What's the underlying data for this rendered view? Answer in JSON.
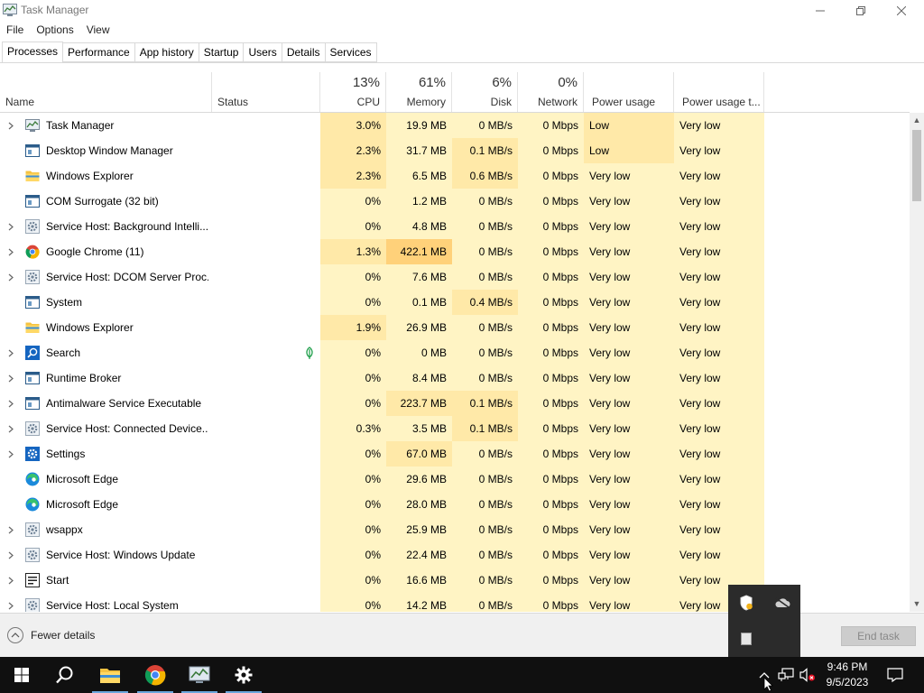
{
  "window": {
    "title": "Task Manager",
    "controls": {
      "minimize": "—",
      "maximize": "❐",
      "close": "✕"
    }
  },
  "menu": [
    "File",
    "Options",
    "View"
  ],
  "tabs": [
    "Processes",
    "Performance",
    "App history",
    "Startup",
    "Users",
    "Details",
    "Services"
  ],
  "active_tab": "Processes",
  "columns": {
    "name": "Name",
    "status": "Status",
    "cpu": {
      "pct": "13%",
      "label": "CPU"
    },
    "memory": {
      "pct": "61%",
      "label": "Memory"
    },
    "disk": {
      "pct": "6%",
      "label": "Disk"
    },
    "network": {
      "pct": "0%",
      "label": "Network"
    },
    "power": "Power usage",
    "power_trend": "Power usage t..."
  },
  "processes": [
    {
      "name": "Task Manager",
      "icon": "task-manager-icon",
      "expandable": true,
      "cpu": "3.0%",
      "memory": "19.9 MB",
      "disk": "0 MB/s",
      "network": "0 Mbps",
      "power": "Low",
      "power_trend": "Very low"
    },
    {
      "name": "Desktop Window Manager",
      "icon": "window-icon",
      "expandable": false,
      "cpu": "2.3%",
      "memory": "31.7 MB",
      "disk": "0.1 MB/s",
      "network": "0 Mbps",
      "power": "Low",
      "power_trend": "Very low"
    },
    {
      "name": "Windows Explorer",
      "icon": "folder-icon",
      "expandable": false,
      "cpu": "2.3%",
      "memory": "6.5 MB",
      "disk": "0.6 MB/s",
      "network": "0 Mbps",
      "power": "Very low",
      "power_trend": "Very low"
    },
    {
      "name": "COM Surrogate (32 bit)",
      "icon": "window-icon",
      "expandable": false,
      "cpu": "0%",
      "memory": "1.2 MB",
      "disk": "0 MB/s",
      "network": "0 Mbps",
      "power": "Very low",
      "power_trend": "Very low"
    },
    {
      "name": "Service Host: Background Intelli...",
      "icon": "gear-icon",
      "expandable": true,
      "cpu": "0%",
      "memory": "4.8 MB",
      "disk": "0 MB/s",
      "network": "0 Mbps",
      "power": "Very low",
      "power_trend": "Very low"
    },
    {
      "name": "Google Chrome (11)",
      "icon": "chrome-icon",
      "expandable": true,
      "cpu": "1.3%",
      "memory": "422.1 MB",
      "disk": "0 MB/s",
      "network": "0 Mbps",
      "power": "Very low",
      "power_trend": "Very low"
    },
    {
      "name": "Service Host: DCOM Server Proc...",
      "icon": "gear-icon",
      "expandable": true,
      "cpu": "0%",
      "memory": "7.6 MB",
      "disk": "0 MB/s",
      "network": "0 Mbps",
      "power": "Very low",
      "power_trend": "Very low"
    },
    {
      "name": "System",
      "icon": "window-icon",
      "expandable": false,
      "cpu": "0%",
      "memory": "0.1 MB",
      "disk": "0.4 MB/s",
      "network": "0 Mbps",
      "power": "Very low",
      "power_trend": "Very low"
    },
    {
      "name": "Windows Explorer",
      "icon": "folder-icon",
      "expandable": false,
      "cpu": "1.9%",
      "memory": "26.9 MB",
      "disk": "0 MB/s",
      "network": "0 Mbps",
      "power": "Very low",
      "power_trend": "Very low"
    },
    {
      "name": "Search",
      "icon": "search-app-icon",
      "expandable": true,
      "status_icon": "suspended-leaf-icon",
      "cpu": "0%",
      "memory": "0 MB",
      "disk": "0 MB/s",
      "network": "0 Mbps",
      "power": "Very low",
      "power_trend": "Very low"
    },
    {
      "name": "Runtime Broker",
      "icon": "window-icon",
      "expandable": true,
      "cpu": "0%",
      "memory": "8.4 MB",
      "disk": "0 MB/s",
      "network": "0 Mbps",
      "power": "Very low",
      "power_trend": "Very low"
    },
    {
      "name": "Antimalware Service Executable",
      "icon": "window-icon",
      "expandable": true,
      "cpu": "0%",
      "memory": "223.7 MB",
      "disk": "0.1 MB/s",
      "network": "0 Mbps",
      "power": "Very low",
      "power_trend": "Very low"
    },
    {
      "name": "Service Host: Connected Device...",
      "icon": "gear-icon",
      "expandable": true,
      "cpu": "0.3%",
      "memory": "3.5 MB",
      "disk": "0.1 MB/s",
      "network": "0 Mbps",
      "power": "Very low",
      "power_trend": "Very low"
    },
    {
      "name": "Settings",
      "icon": "settings-app-icon",
      "expandable": true,
      "cpu": "0%",
      "memory": "67.0 MB",
      "disk": "0 MB/s",
      "network": "0 Mbps",
      "power": "Very low",
      "power_trend": "Very low"
    },
    {
      "name": "Microsoft Edge",
      "icon": "edge-icon",
      "expandable": false,
      "cpu": "0%",
      "memory": "29.6 MB",
      "disk": "0 MB/s",
      "network": "0 Mbps",
      "power": "Very low",
      "power_trend": "Very low"
    },
    {
      "name": "Microsoft Edge",
      "icon": "edge-icon",
      "expandable": false,
      "cpu": "0%",
      "memory": "28.0 MB",
      "disk": "0 MB/s",
      "network": "0 Mbps",
      "power": "Very low",
      "power_trend": "Very low"
    },
    {
      "name": "wsappx",
      "icon": "gear-icon",
      "expandable": true,
      "cpu": "0%",
      "memory": "25.9 MB",
      "disk": "0 MB/s",
      "network": "0 Mbps",
      "power": "Very low",
      "power_trend": "Very low"
    },
    {
      "name": "Service Host: Windows Update",
      "icon": "gear-icon",
      "expandable": true,
      "cpu": "0%",
      "memory": "22.4 MB",
      "disk": "0 MB/s",
      "network": "0 Mbps",
      "power": "Very low",
      "power_trend": "Very low"
    },
    {
      "name": "Start",
      "icon": "start-app-icon",
      "expandable": true,
      "cpu": "0%",
      "memory": "16.6 MB",
      "disk": "0 MB/s",
      "network": "0 Mbps",
      "power": "Very low",
      "power_trend": "Very low"
    },
    {
      "name": "Service Host: Local System",
      "icon": "gear-icon",
      "expandable": true,
      "cpu": "0%",
      "memory": "14.2 MB",
      "disk": "0 MB/s",
      "network": "0 Mbps",
      "power": "Very low",
      "power_trend": "Very low"
    }
  ],
  "footer": {
    "fewer_details": "Fewer details",
    "end_task": "End task"
  },
  "taskbar": {
    "apps": [
      "start-icon",
      "search-icon",
      "file-explorer-icon",
      "chrome-icon",
      "task-manager-icon",
      "settings-icon"
    ],
    "time": "9:46 PM",
    "date": "9/5/2023"
  },
  "colors": {
    "heat_light": "#fff4c4",
    "heat_mid": "#ffe9a8",
    "heat_high": "#ffd17a",
    "taskbar": "#101010",
    "accent": "#6aa6dc"
  }
}
